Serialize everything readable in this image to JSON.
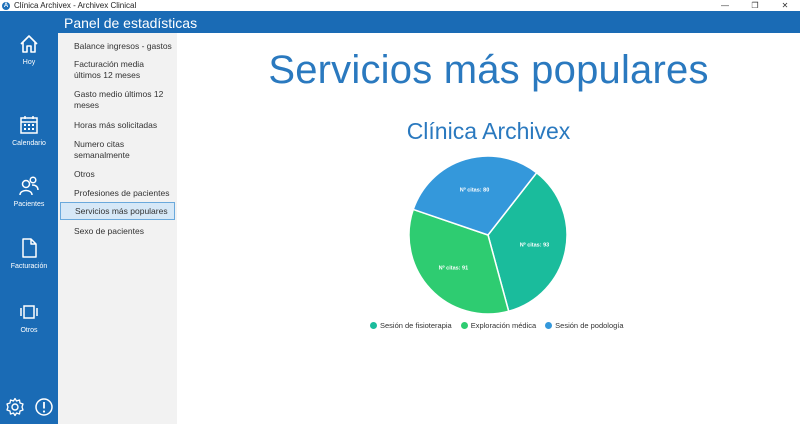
{
  "window": {
    "title": "Clínica Archivex - Archivex Clinical",
    "minimize": "—",
    "restore": "❐",
    "close": "✕"
  },
  "header": {
    "title": "Panel de estadísticas"
  },
  "nav": {
    "items": [
      {
        "label": "Hoy",
        "icon": "home-icon"
      },
      {
        "label": "Calendario",
        "icon": "calendar-icon"
      },
      {
        "label": "Pacientes",
        "icon": "patients-icon"
      },
      {
        "label": "Facturación",
        "icon": "document-icon"
      },
      {
        "label": "Otros",
        "icon": "carousel-icon"
      }
    ],
    "bottom": [
      "gear-icon",
      "info-icon"
    ]
  },
  "submenu": {
    "items": [
      "Balance ingresos - gastos",
      "Facturación media últimos 12 meses",
      "Gasto medio últimos 12 meses",
      "Horas más solicitadas",
      "Numero citas semanalmente",
      "Otros",
      "Profesiones de pacientes",
      "Servicios más populares",
      "Sexo de pacientes"
    ],
    "active_index": 7
  },
  "main": {
    "title": "Servicios más populares"
  },
  "chart_data": {
    "type": "pie",
    "title": "Clínica Archivex",
    "categories": [
      "Sesión de fisioterapia",
      "Exploración médica",
      "Sesión de podología"
    ],
    "values": [
      93,
      91,
      80
    ],
    "labels": [
      "Nº citas: 93",
      "Nº citas: 91",
      "Nº citas: 80"
    ],
    "colors": [
      "#1abc9c",
      "#2ecc71",
      "#3498db"
    ],
    "legend_position": "bottom"
  }
}
